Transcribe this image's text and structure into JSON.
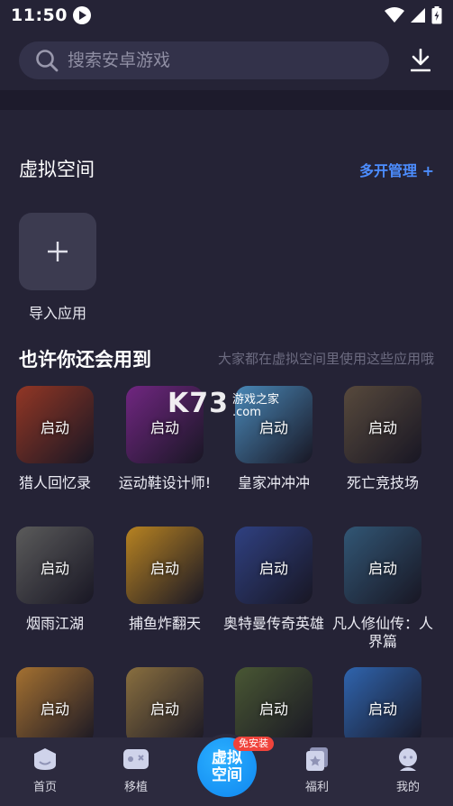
{
  "status": {
    "time": "11:50"
  },
  "search": {
    "placeholder": "搜索安卓游戏"
  },
  "virtual_space": {
    "title": "虚拟空间",
    "manage_label": "多开管理 +",
    "import_label": "导入应用"
  },
  "recommend": {
    "title": "也许你还会用到",
    "subtitle": "大家都在虚拟空间里使用这些应用哦"
  },
  "apps": [
    {
      "name": "猎人回忆录",
      "launch": "启动",
      "color": "#b3432e"
    },
    {
      "name": "运动鞋设计师!",
      "launch": "启动",
      "color": "#8a2f9e"
    },
    {
      "name": "皇家冲冲冲",
      "launch": "启动",
      "color": "#5aa6e0"
    },
    {
      "name": "死亡竞技场",
      "launch": "启动",
      "color": "#6b5a4a"
    },
    {
      "name": "烟雨江湖",
      "launch": "启动",
      "color": "#6f6f6f"
    },
    {
      "name": "捕鱼炸翻天",
      "launch": "启动",
      "color": "#e0a02a"
    },
    {
      "name": "奥特曼传奇英雄",
      "launch": "启动",
      "color": "#3a4f9e"
    },
    {
      "name": "凡人修仙传：人界篇",
      "launch": "启动",
      "color": "#3d6a8f"
    },
    {
      "name": "",
      "launch": "启动",
      "color": "#c98a3c"
    },
    {
      "name": "",
      "launch": "启动",
      "color": "#a8884e"
    },
    {
      "name": "",
      "launch": "启动",
      "color": "#5a6b3f"
    },
    {
      "name": "",
      "launch": "启动",
      "color": "#3a7bd5"
    }
  ],
  "watermark": {
    "logo": "K73",
    "site": "游戏之家\n.com"
  },
  "nav": {
    "home": "首页",
    "port": "移植",
    "center": "虚拟空间",
    "badge": "免安装",
    "welfare": "福利",
    "mine": "我的"
  }
}
